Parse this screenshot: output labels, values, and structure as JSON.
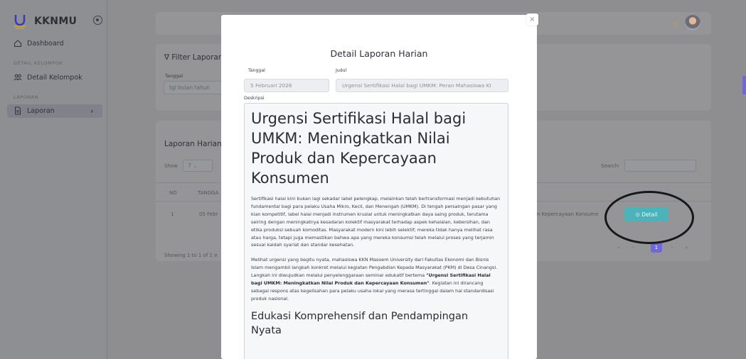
{
  "sidebar": {
    "brand": "KKNMU",
    "items": [
      {
        "label": "Dashboard"
      },
      {
        "label": "Detail Kelompok"
      },
      {
        "label": "Laporan"
      }
    ],
    "sections": [
      "DETAIL KELOMPOK",
      "LAPORAN"
    ]
  },
  "page": {
    "filter": {
      "title": "Filter Laporan",
      "date_label": "Tanggal",
      "date_placeholder": "tgl bulan tahun"
    },
    "report": {
      "title": "Laporan Harian",
      "show_prefix": "Show",
      "show_value": "7",
      "search_label": "Search:",
      "columns": [
        "NO",
        "TANGGA"
      ],
      "row": {
        "no": "1",
        "date": "05 Febr",
        "title_tail": "n Kepercayaan Konsume"
      },
      "detail_button": "Detail",
      "showing": "Showing 1 to 1 of 1 e",
      "pagination": [
        "«",
        "‹",
        "1",
        "›",
        "»"
      ]
    }
  },
  "modal": {
    "title": "Detail Laporan Harian",
    "date_label": "Tanggal",
    "date_value": "5 Februari 2026",
    "title_label": "Judul",
    "title_value": "Urgensi Sertifikasi Halal bagi UMKM: Peran Mahasiswa KI",
    "desc_label": "Deskripsi",
    "desc_heading": "Urgensi Sertifikasi Halal bagi UMKM: Meningkatkan Nilai Produk dan Kepercayaan Konsumen",
    "paragraph1": "Sertifikasi halal kini bukan lagi sekadar label pelengkap, melainkan telah bertransformasi menjadi kebutuhan fundamental bagi para pelaku Usaha Mikro, Kecil, dan Menengah (UMKM). Di tengah persaingan pasar yang kian kompetitif, label halal menjadi instrumen krusial untuk meningkatkan daya saing produk, terutama seiring dengan meningkatnya kesadaran kolektif masyarakat terhadap aspek kehalalan, kebersihan, dan etika produksi sebuah komoditas. Masyarakat modern kini lebih selektif; mereka tidak hanya melihat rasa atau harga, tetapi juga memastikan bahwa apa yang mereka konsumsi telah melalui proses yang terjamin sesuai kaidah syariat dan standar kesehatan.",
    "paragraph2_before": "Melihat urgensi yang begitu nyata, mahasiswa KKN Masoem University dari Fakultas Ekonomi dan Bisnis Islam mengambil langkah konkret melalui kegiatan Pengabdian Kepada Masyarakat (PKM) di Desa Cinangsi. Langkah ini diwujudkan melalui penyelenggaraan seminar edukatif bertema ",
    "paragraph2_bold": "\"Urgensi Sertifikasi Halal bagi UMKM: Meningkatkan Nilai Produk dan Kepercayaan Konsumen\"",
    "paragraph2_after": ". Kegiatan ini dirancang sebagai respons atas kegelisahan para pelaku usaha lokal yang merasa tertinggal dalam hal standardisasi produk nasional.",
    "subheading": "Edukasi Komprehensif dan Pendampingan Nyata",
    "close": "×"
  },
  "colors": {
    "overlay": "#8e8e90",
    "detail_button": "#4bb3b9",
    "accent": "#7168d8"
  }
}
